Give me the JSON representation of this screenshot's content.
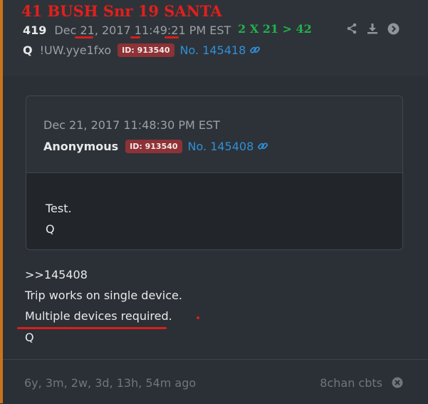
{
  "overlay": {
    "title": "41 BUSH Snr  19 SANTA",
    "equation": "2 X 21 > 42"
  },
  "post": {
    "number": "419",
    "date": "Dec 21, 2017 11:49:21 PM EST",
    "name": "Q",
    "tripcode": "!UW.yye1fxo",
    "id_badge": "ID: 913540",
    "post_link": "No. 145418",
    "actions": [
      "share-icon",
      "download-icon",
      "arrow-right-circle-icon"
    ]
  },
  "quoted": {
    "date": "Dec 21, 2017 11:48:30 PM EST",
    "name": "Anonymous",
    "id_badge": "ID: 913540",
    "post_link": "No. 145408",
    "lines": [
      "Test.",
      "Q"
    ]
  },
  "body": {
    "lines": [
      ">>145408",
      "Trip works on single device.",
      "Multiple devices required.",
      "Q"
    ]
  },
  "footer": {
    "age": "6y, 3m, 2w, 3d, 13h, 54m ago",
    "source": "8chan cbts"
  },
  "colors": {
    "accent": "#c9741c",
    "overlay_red": "#e0201c",
    "overlay_green": "#22b14c",
    "link": "#2f8fd8",
    "id_badge": "#8d3236"
  }
}
